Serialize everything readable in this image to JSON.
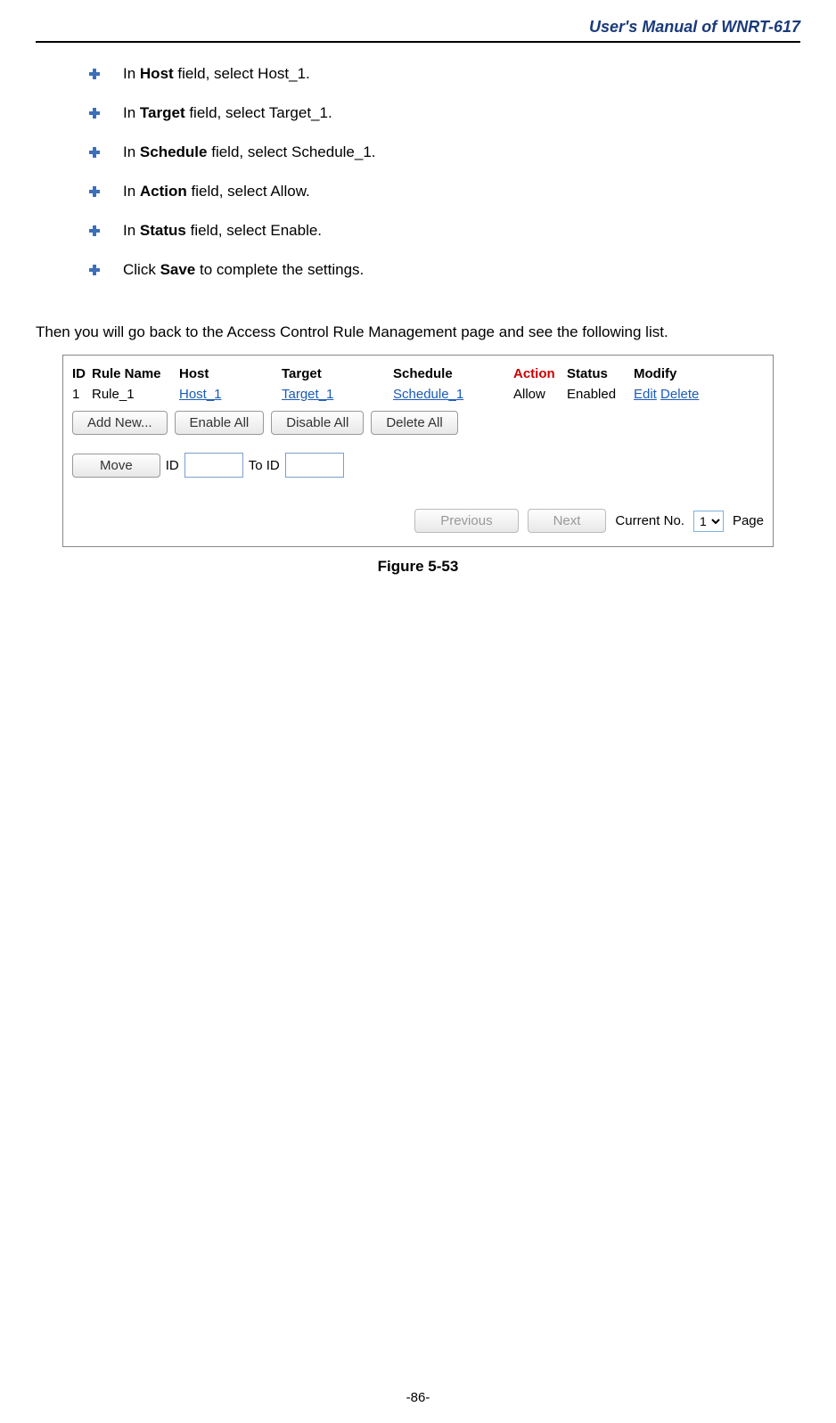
{
  "header": "User's Manual of WNRT-617",
  "bullets": [
    {
      "pre": "In ",
      "bold": "Host",
      "post": " field, select Host_1."
    },
    {
      "pre": "In ",
      "bold": "Target",
      "post": " field, select Target_1."
    },
    {
      "pre": "In ",
      "bold": "Schedule",
      "post": " field, select Schedule_1."
    },
    {
      "pre": "In ",
      "bold": "Action",
      "post": " field, select Allow."
    },
    {
      "pre": "In ",
      "bold": "Status",
      "post": " field, select Enable."
    },
    {
      "pre": "Click ",
      "bold": "Save",
      "post": " to complete the settings."
    }
  ],
  "intro": "Then you will go back to the Access Control Rule Management page and see the following list.",
  "table": {
    "headers": {
      "id": "ID",
      "rulename": "Rule Name",
      "host": "Host",
      "target": "Target",
      "schedule": "Schedule",
      "action": "Action",
      "status": "Status",
      "modify": "Modify"
    },
    "row": {
      "id": "1",
      "rulename": "Rule_1",
      "host": "Host_1",
      "target": "Target_1",
      "schedule": "Schedule_1",
      "action": "Allow",
      "status": "Enabled",
      "edit": "Edit",
      "delete": "Delete"
    }
  },
  "buttons": {
    "addnew": "Add New...",
    "enableall": "Enable All",
    "disableall": "Disable All",
    "deleteall": "Delete All",
    "move": "Move",
    "previous": "Previous",
    "next": "Next"
  },
  "labels": {
    "id_label": "ID",
    "toid_label": "To ID",
    "currentno": "Current No.",
    "page": "Page"
  },
  "page_select": "1",
  "figure_caption": "Figure 5-53",
  "page_number": "-86-"
}
